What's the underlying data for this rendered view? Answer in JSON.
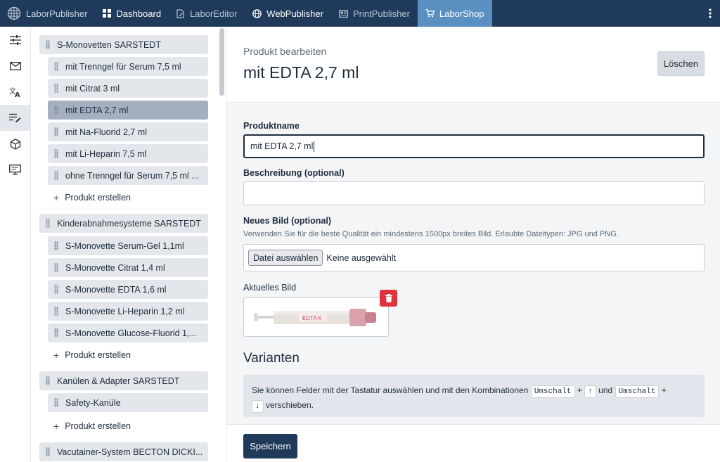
{
  "topbar": {
    "items": [
      {
        "label": "LaborPublisher",
        "icon": "globe-grid-icon"
      },
      {
        "label": "Dashboard",
        "icon": "dashboard-icon"
      },
      {
        "label": "LaborEditor",
        "icon": "edit-document-icon"
      },
      {
        "label": "WebPublisher",
        "icon": "globe-icon"
      },
      {
        "label": "PrintPublisher",
        "icon": "newspaper-icon"
      },
      {
        "label": "LaborShop",
        "icon": "cart-icon"
      }
    ],
    "more_icon": "kebab-menu-icon",
    "active_color": "#5a8fc2",
    "bar_color": "#1f3a5a"
  },
  "rail": {
    "icons": [
      "sliders-icon",
      "mail-icon",
      "translate-icon",
      "list-edit-icon",
      "cube-icon",
      "monitor-icon"
    ],
    "active_index": 3
  },
  "tree": {
    "groups": [
      {
        "label": "S-Monovetten SARSTEDT",
        "items": [
          "mit Trenngel für Serum 7,5 ml",
          "mit Citrat 3 ml",
          "mit EDTA 2,7 ml",
          "mit Na-Fluorid 2,7 ml",
          "mit Li-Heparin 7,5 ml",
          "ohne Trenngel für Serum 7,5 ml ..."
        ],
        "add_label": "Produkt erstellen"
      },
      {
        "label": "Kinderabnahmesysteme SARSTEDT",
        "items": [
          "S-Monovette Serum-Gel 1,1ml",
          "S-Monovette Citrat 1,4 ml",
          "S-Monovette EDTA 1,6 ml",
          "S-Monovette Li-Heparin 1,2 ml",
          "S-Monovette Glucose-Fluorid 1,..."
        ],
        "add_label": "Produkt erstellen"
      },
      {
        "label": "Kanülen & Adapter SARSTEDT",
        "items": [
          "Safety-Kanüle"
        ],
        "add_label": "Produkt erstellen"
      },
      {
        "label": "Vacutainer-System BECTON DICKI...",
        "items": [],
        "add_label": ""
      }
    ],
    "selected": "mit EDTA 2,7 ml"
  },
  "main": {
    "subtitle": "Produkt bearbeiten",
    "title": "mit EDTA 2,7 ml",
    "delete_label": "Löschen",
    "name_label": "Produktname",
    "name_value": "mit EDTA 2,7 ml",
    "desc_label": "Beschreibung (optional)",
    "desc_value": "",
    "image_label": "Neues Bild (optional)",
    "image_hint": "Verwenden Sie für die beste Qualität ein mindestens 1500px breites Bild. Erlaubte Dateitypen: JPG und PNG.",
    "file_button": "Datei auswählen",
    "file_status": "Keine ausgewählt",
    "current_image_label": "Aktuelles Bild",
    "tube_label": "EDTA K",
    "variants_title": "Varianten",
    "variants_info": {
      "part1": "Sie können Felder mit der Tastatur auswählen und mit den Kombinationen",
      "key1": "Umschalt",
      "plus1": "+",
      "arrow_up": "↑",
      "and": "und",
      "key2": "Umschalt",
      "plus2": "+",
      "arrow_down": "↓",
      "part2": "verschieben."
    },
    "save_label": "Speichern"
  }
}
